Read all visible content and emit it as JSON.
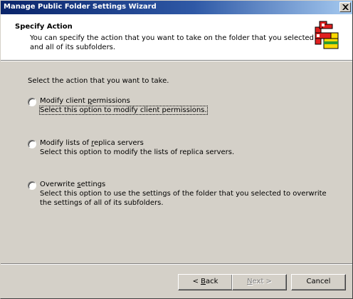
{
  "window": {
    "title": "Manage Public Folder Settings Wizard"
  },
  "header": {
    "title": "Specify Action",
    "description": "You can specify the action that you want to take on the folder that you selected and all of its subfolders.",
    "icon": "wizard-icon"
  },
  "body": {
    "prompt": "Select the action that you want to take."
  },
  "options": [
    {
      "label_pre": "Modify client ",
      "label_accel": "p",
      "label_post": "ermissions",
      "description": "Select this option to modify client permissions.",
      "selected": false
    },
    {
      "label_pre": "Modify lists of ",
      "label_accel": "r",
      "label_post": "eplica servers",
      "description": "Select this option to modify the lists of replica servers.",
      "selected": false
    },
    {
      "label_pre": "Overwrite ",
      "label_accel": "s",
      "label_post": "ettings",
      "description": "Select this option to use the settings of the folder that you selected to overwrite the settings of all of its subfolders.",
      "selected": false
    }
  ],
  "buttons": {
    "back_pre": "< ",
    "back_accel": "B",
    "back_post": "ack",
    "next_pre": "",
    "next_accel": "N",
    "next_post": "ext >",
    "cancel": "Cancel"
  }
}
